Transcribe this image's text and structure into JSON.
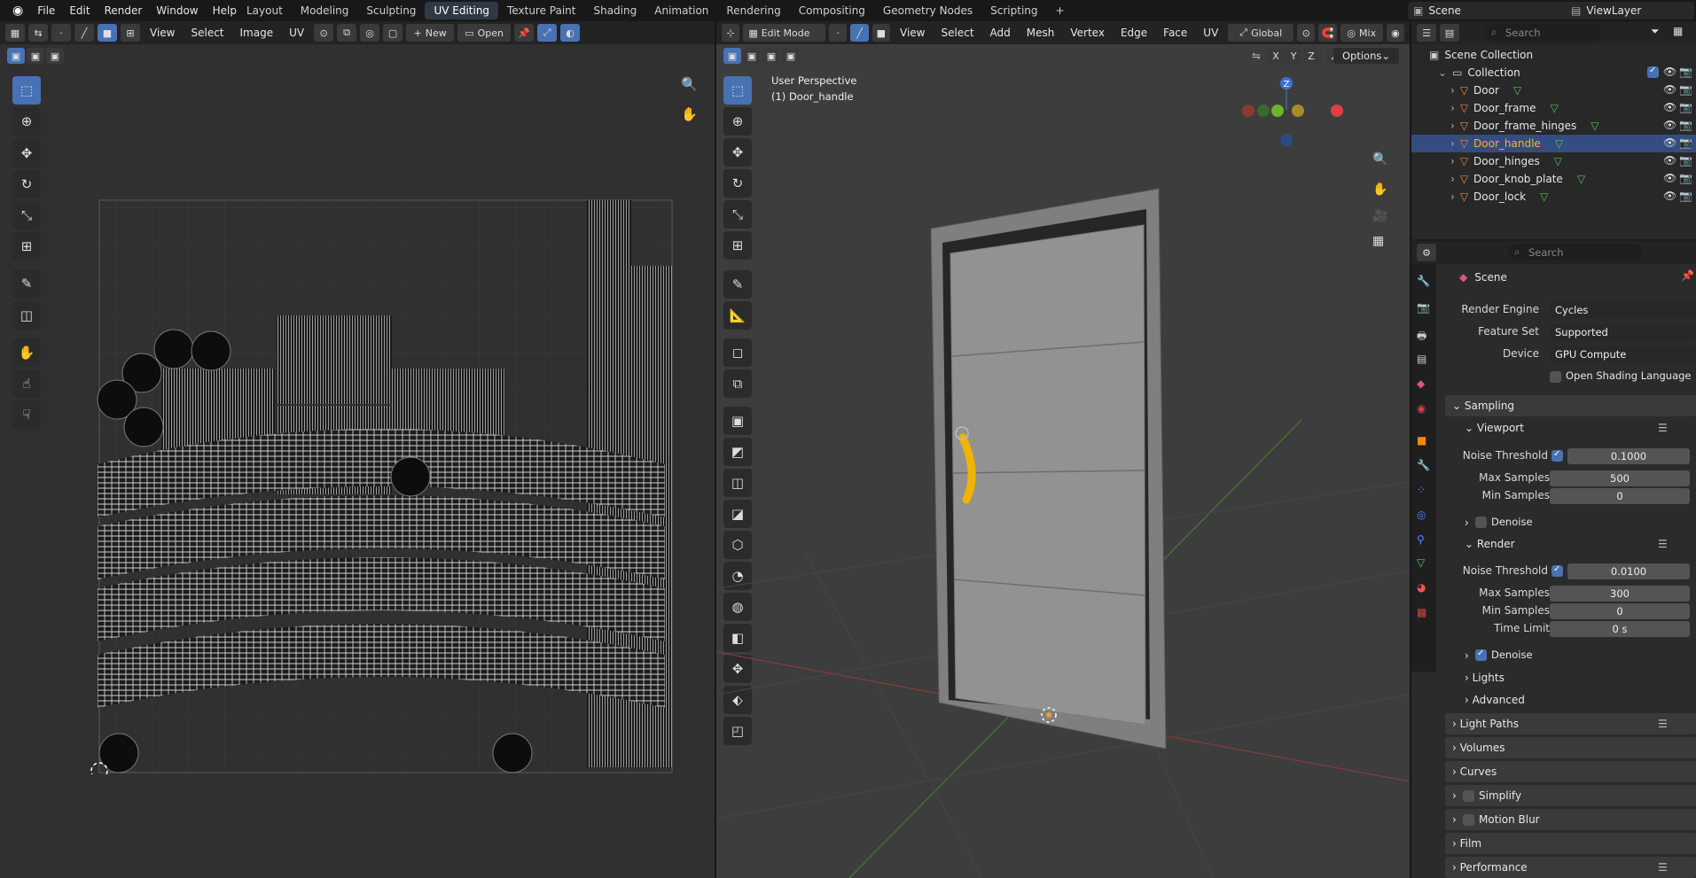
{
  "menu": [
    "File",
    "Edit",
    "Render",
    "Window",
    "Help"
  ],
  "workspaces": [
    "Layout",
    "Modeling",
    "Sculpting",
    "UV Editing",
    "Texture Paint",
    "Shading",
    "Animation",
    "Rendering",
    "Compositing",
    "Geometry Nodes",
    "Scripting"
  ],
  "active_workspace": "UV Editing",
  "scene": {
    "name": "Scene",
    "view_layer": "ViewLayer"
  },
  "uv_editor": {
    "menus": [
      "View",
      "Select",
      "Image",
      "UV"
    ],
    "new_label": "New",
    "open_label": "Open"
  },
  "viewport": {
    "mode": "Edit Mode",
    "menus": [
      "View",
      "Select",
      "Add",
      "Mesh",
      "Vertex",
      "Edge",
      "Face",
      "UV"
    ],
    "orientation": "Global",
    "shading": "Mix",
    "options_label": "Options",
    "axes": [
      "X",
      "Y",
      "Z"
    ],
    "overlay_title": "User Perspective",
    "overlay_object": "(1) Door_handle",
    "gizmo_z": "Z"
  },
  "outliner": {
    "search_placeholder": "Search",
    "scene_collection": "Scene Collection",
    "collection": "Collection",
    "items": [
      "Door",
      "Door_frame",
      "Door_frame_hinges",
      "Door_handle",
      "Door_hinges",
      "Door_knob_plate",
      "Door_lock"
    ],
    "selected": "Door_handle"
  },
  "properties": {
    "search_placeholder": "Search",
    "context": "Scene",
    "render_engine_label": "Render Engine",
    "render_engine": "Cycles",
    "feature_set_label": "Feature Set",
    "feature_set": "Supported",
    "device_label": "Device",
    "device": "GPU Compute",
    "osl_label": "Open Shading Language",
    "sampling": "Sampling",
    "viewport": "Viewport",
    "vp_noise_label": "Noise Threshold",
    "vp_noise": "0.1000",
    "vp_max_label": "Max Samples",
    "vp_max": "500",
    "vp_min_label": "Min Samples",
    "vp_min": "0",
    "denoise": "Denoise",
    "render": "Render",
    "r_noise_label": "Noise Threshold",
    "r_noise": "0.0100",
    "r_max_label": "Max Samples",
    "r_max": "300",
    "r_min_label": "Min Samples",
    "r_min": "0",
    "time_limit_label": "Time Limit",
    "time_limit": "0 s",
    "r_denoise": "Denoise",
    "lights": "Lights",
    "advanced": "Advanced",
    "light_paths": "Light Paths",
    "volumes": "Volumes",
    "curves": "Curves",
    "simplify": "Simplify",
    "motion_blur": "Motion Blur",
    "film": "Film",
    "performance": "Performance"
  },
  "colors": {
    "accent": "#4772b3",
    "selected_obj": "#f0b400",
    "highlight_text": "#ffaf29"
  }
}
